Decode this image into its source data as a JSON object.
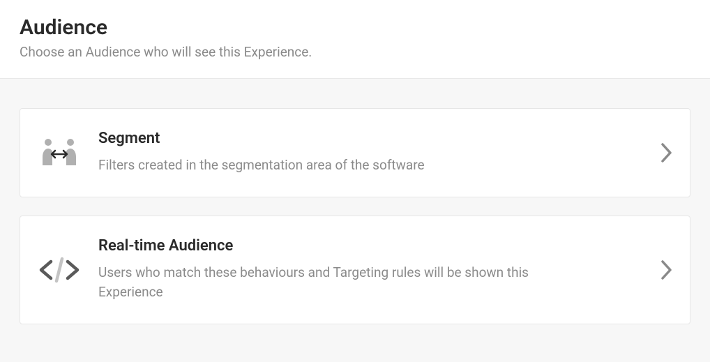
{
  "header": {
    "title": "Audience",
    "subtitle": "Choose an Audience who will see this Experience."
  },
  "cards": [
    {
      "title": "Segment",
      "description": "Filters created in the segmentation area of the software"
    },
    {
      "title": "Real-time Audience",
      "description": "Users who match these behaviours and Targeting rules will be shown this Experience"
    }
  ]
}
